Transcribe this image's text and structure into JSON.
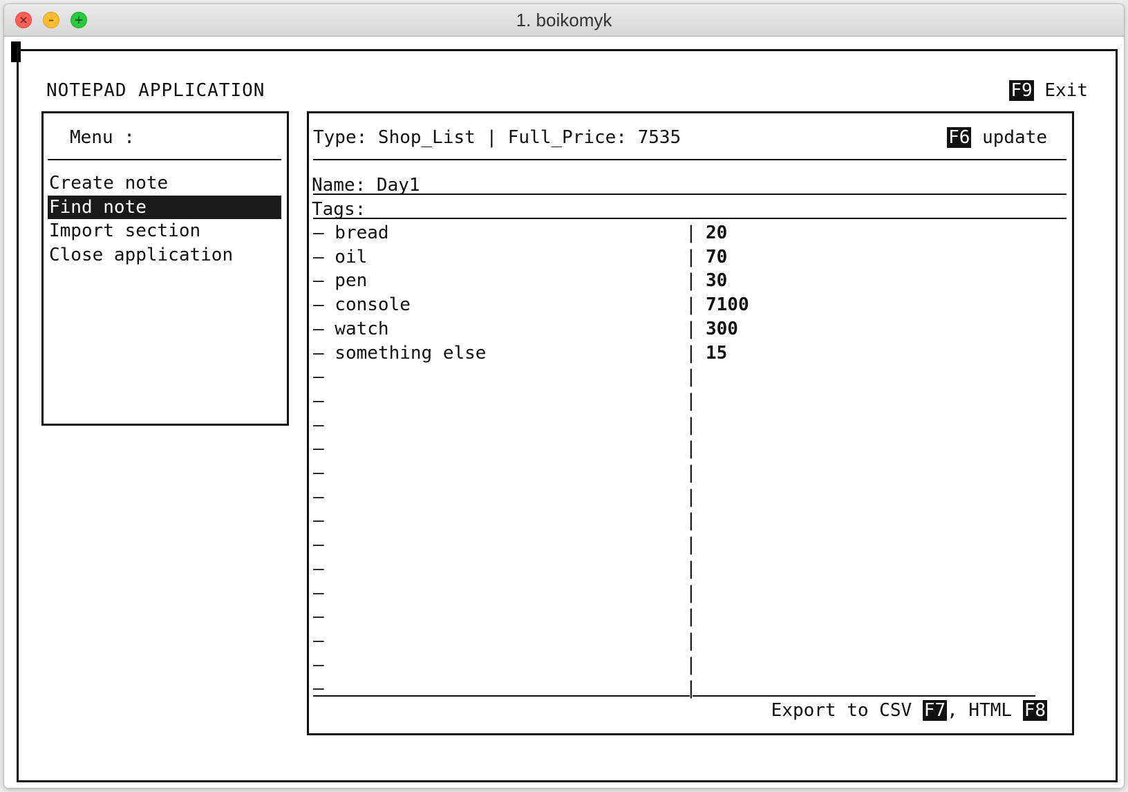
{
  "window": {
    "title": "1. boikomyk"
  },
  "app": {
    "title": "NOTEPAD APPLICATION",
    "exit_key": "F9",
    "exit_label": "Exit"
  },
  "menu": {
    "title": "Menu :",
    "items": [
      {
        "label": "Create note",
        "selected": false
      },
      {
        "label": "Find note",
        "selected": true
      },
      {
        "label": "Import section",
        "selected": false
      },
      {
        "label": "Close application",
        "selected": false
      }
    ]
  },
  "note": {
    "header": "Type: Shop_List | Full_Price: 7535",
    "update_key": "F6",
    "update_label": "update",
    "name_line": "Name: Day1",
    "tags_line": "Tags:",
    "rows": [
      {
        "name": "– bread",
        "sep": "|",
        "value": "20"
      },
      {
        "name": "– oil",
        "sep": "|",
        "value": "70"
      },
      {
        "name": "– pen",
        "sep": "|",
        "value": "30"
      },
      {
        "name": "– console",
        "sep": "|",
        "value": "7100"
      },
      {
        "name": "– watch",
        "sep": "|",
        "value": "300"
      },
      {
        "name": "– something else",
        "sep": "|",
        "value": "15"
      },
      {
        "name": "–",
        "sep": "|",
        "value": ""
      },
      {
        "name": "–",
        "sep": "|",
        "value": ""
      },
      {
        "name": "–",
        "sep": "|",
        "value": ""
      },
      {
        "name": "–",
        "sep": "|",
        "value": ""
      },
      {
        "name": "–",
        "sep": "|",
        "value": ""
      },
      {
        "name": "–",
        "sep": "|",
        "value": ""
      },
      {
        "name": "–",
        "sep": "|",
        "value": ""
      },
      {
        "name": "–",
        "sep": "|",
        "value": ""
      },
      {
        "name": "–",
        "sep": "|",
        "value": ""
      },
      {
        "name": "–",
        "sep": "|",
        "value": ""
      },
      {
        "name": "–",
        "sep": "|",
        "value": ""
      },
      {
        "name": "–",
        "sep": "|",
        "value": ""
      },
      {
        "name": "–",
        "sep": "|",
        "value": ""
      },
      {
        "name": "–",
        "sep": "|",
        "value": ""
      }
    ],
    "export_prefix": "Export to CSV ",
    "export_csv_key": "F7",
    "export_mid": ", HTML ",
    "export_html_key": "F8"
  }
}
